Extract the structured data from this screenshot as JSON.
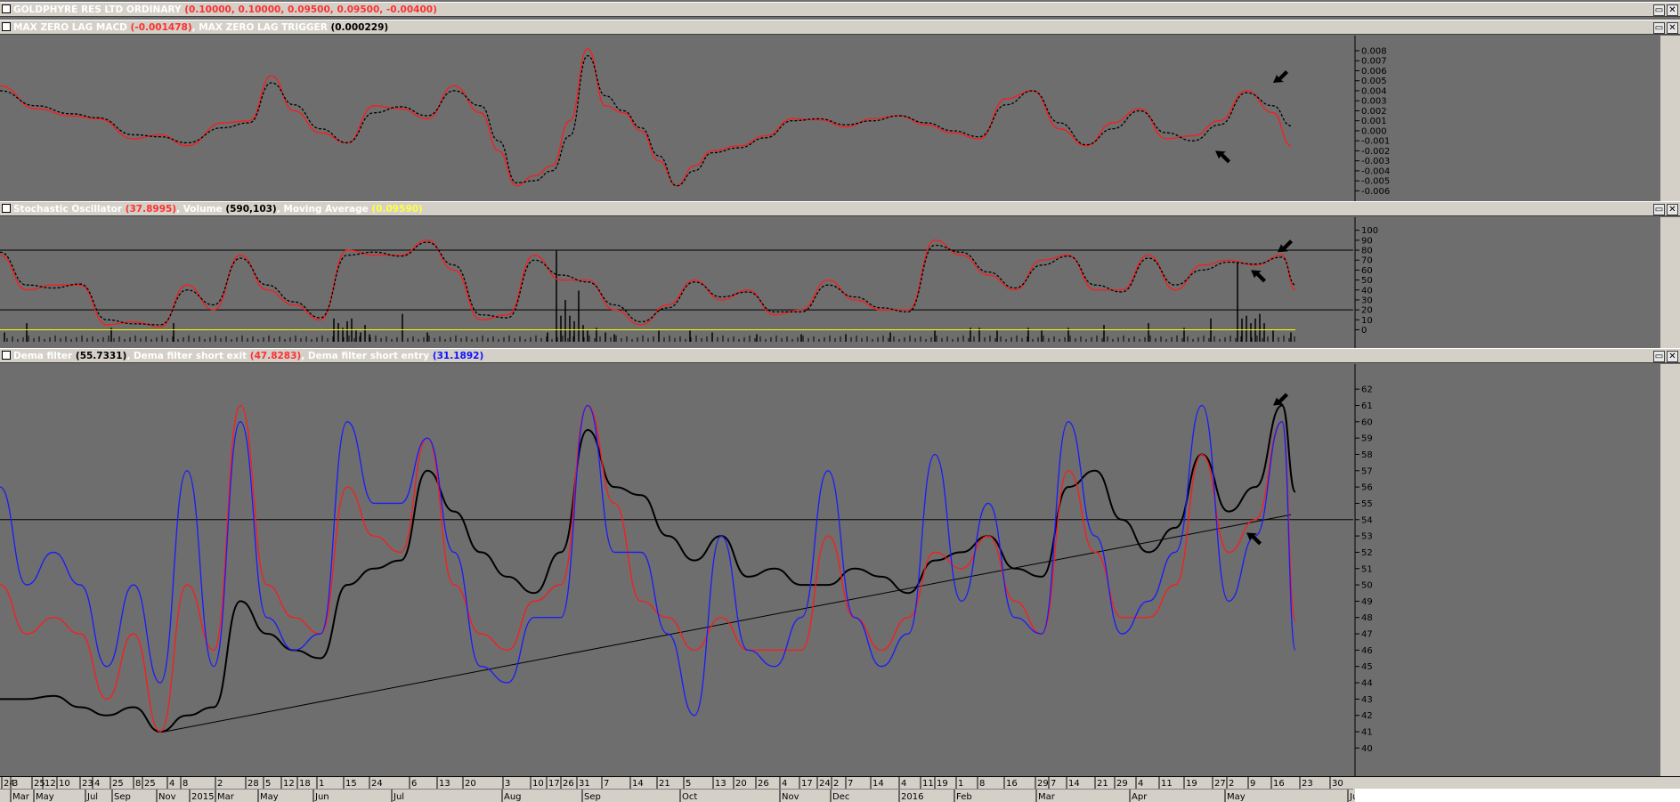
{
  "bars": [
    {
      "name": "GOLDPHYRE RES LTD ORDINARY",
      "value": "(0.10000, 0.10000, 0.09500, 0.09500, -0.00400)"
    },
    {
      "parts": [
        {
          "t": "MAX ZERO LAG MACD ",
          "c": "w"
        },
        {
          "t": "(-0.001478)",
          "c": "red"
        },
        {
          "t": ", MAX ZERO LAG TRIGGER ",
          "c": "w"
        },
        {
          "t": "(0.000229)",
          "c": "blk"
        }
      ]
    },
    {
      "parts": [
        {
          "t": "Stochastic Oscillator ",
          "c": "w"
        },
        {
          "t": "(37.8995)",
          "c": "red"
        },
        {
          "t": ", Volume ",
          "c": "w"
        },
        {
          "t": "(590,103)",
          "c": "blk"
        },
        {
          "t": ", Moving Average ",
          "c": "w"
        },
        {
          "t": "(0.09590)",
          "c": "yel"
        }
      ]
    },
    {
      "parts": [
        {
          "t": "Dema filter ",
          "c": "w"
        },
        {
          "t": "(55.7331)",
          "c": "blk"
        },
        {
          "t": ", Dema filter short exit ",
          "c": "w"
        },
        {
          "t": "(47.8283)",
          "c": "red"
        },
        {
          "t": ", Dema filter short entry ",
          "c": "w"
        },
        {
          "t": "(31.1892)",
          "c": "blu"
        }
      ]
    }
  ],
  "buttons": {
    "restore": "▭",
    "close": "✕"
  },
  "colors": {
    "background": "#6e6e6e",
    "red": "#ff1a1a",
    "black": "#000000",
    "blue": "#1a1aff",
    "yellow": "#ffff00",
    "axis": "#d4d0c8"
  },
  "chart_data": [
    {
      "type": "line",
      "id": "macd",
      "ylim": [
        -0.0065,
        0.0088
      ],
      "yticks": [
        "0.008",
        "0.007",
        "0.006",
        "0.005",
        "0.004",
        "0.003",
        "0.002",
        "0.001",
        "0.000",
        "-0.001",
        "-0.002",
        "-0.003",
        "-0.004",
        "-0.005",
        "-0.006"
      ],
      "ytick_values": [
        0.008,
        0.007,
        0.006,
        0.005,
        0.004,
        0.003,
        0.002,
        0.001,
        0.0,
        -0.001,
        -0.002,
        -0.003,
        -0.004,
        -0.005,
        -0.006
      ],
      "x": [
        0,
        40,
        80,
        110,
        150,
        180,
        210,
        250,
        280,
        305,
        330,
        360,
        390,
        420,
        450,
        480,
        510,
        540,
        560,
        580,
        600,
        620,
        640,
        660,
        680,
        700,
        720,
        740,
        760,
        780,
        800,
        830,
        860,
        890,
        920,
        950,
        980,
        1010,
        1040,
        1070,
        1100,
        1130,
        1160,
        1190,
        1220,
        1250,
        1280,
        1310,
        1340,
        1370,
        1400,
        1430,
        1450
      ],
      "series": [
        {
          "name": "MAX ZERO LAG MACD",
          "color": "red",
          "style": "solid",
          "values": [
            0.0045,
            0.0022,
            0.0015,
            0.0012,
            -0.0008,
            -0.0004,
            -0.0015,
            0.0008,
            0.001,
            0.0055,
            0.002,
            -0.0002,
            -0.0012,
            0.0025,
            0.0022,
            0.0012,
            0.0045,
            0.0018,
            -0.002,
            -0.0055,
            -0.0045,
            -0.0035,
            0.001,
            0.0082,
            0.0025,
            0.0018,
            0.0,
            -0.003,
            -0.0055,
            -0.0035,
            -0.002,
            -0.0015,
            -0.0005,
            0.0012,
            0.0011,
            0.0004,
            0.0012,
            0.0015,
            0.0006,
            -0.0002,
            -0.0008,
            0.0032,
            0.004,
            0.0002,
            -0.0015,
            0.0008,
            0.0022,
            -0.0008,
            -0.0005,
            0.001,
            0.004,
            0.0018,
            -0.0015
          ]
        },
        {
          "name": "MAX ZERO LAG TRIGGER",
          "color": "black",
          "style": "dashed",
          "values": [
            0.004,
            0.0025,
            0.0017,
            0.0013,
            -0.0004,
            -0.0006,
            -0.0012,
            0.0003,
            0.0008,
            0.0048,
            0.0026,
            0.0002,
            -0.0012,
            0.0018,
            0.0024,
            0.0015,
            0.004,
            0.0025,
            -0.001,
            -0.0052,
            -0.005,
            -0.004,
            -0.0005,
            0.0075,
            0.0035,
            0.002,
            0.0003,
            -0.0025,
            -0.0055,
            -0.004,
            -0.0022,
            -0.0017,
            -0.0007,
            0.001,
            0.0012,
            0.0006,
            0.001,
            0.0015,
            0.0008,
            0.0,
            -0.0006,
            0.0026,
            0.004,
            0.0008,
            -0.0014,
            0.0002,
            0.002,
            -0.0002,
            -0.001,
            0.0006,
            0.0038,
            0.0025,
            0.0005
          ]
        }
      ],
      "annotations": [
        {
          "type": "arrow",
          "dir": "down-left",
          "x": 1430,
          "value": 0.0048
        },
        {
          "type": "arrow",
          "dir": "up-left",
          "x": 1365,
          "value": -0.002
        }
      ]
    },
    {
      "type": "line",
      "id": "stochastic",
      "ylim": [
        -13,
        106
      ],
      "yticks": [
        "100",
        "90",
        "80",
        "70",
        "60",
        "50",
        "40",
        "30",
        "20",
        "10",
        "0"
      ],
      "ytick_values": [
        100,
        90,
        80,
        70,
        60,
        50,
        40,
        30,
        20,
        10,
        0
      ],
      "hlines": [
        80,
        20
      ],
      "x": [
        0,
        30,
        60,
        90,
        120,
        150,
        180,
        210,
        240,
        270,
        300,
        330,
        360,
        390,
        420,
        450,
        480,
        510,
        540,
        570,
        600,
        630,
        660,
        690,
        720,
        750,
        780,
        810,
        840,
        870,
        900,
        930,
        960,
        990,
        1020,
        1050,
        1080,
        1110,
        1140,
        1170,
        1200,
        1230,
        1260,
        1290,
        1320,
        1350,
        1380,
        1410,
        1440,
        1455
      ],
      "series": [
        {
          "name": "Stochastic Oscillator",
          "color": "red",
          "style": "solid",
          "values": [
            75,
            40,
            45,
            45,
            5,
            8,
            3,
            45,
            20,
            75,
            40,
            25,
            10,
            80,
            75,
            75,
            90,
            60,
            10,
            15,
            75,
            50,
            50,
            20,
            5,
            25,
            50,
            30,
            40,
            15,
            20,
            50,
            30,
            20,
            20,
            90,
            75,
            55,
            40,
            70,
            75,
            40,
            40,
            75,
            40,
            65,
            70,
            65,
            75,
            40
          ]
        },
        {
          "name": "Stochastic Signal",
          "color": "black",
          "style": "dashed",
          "values": [
            78,
            45,
            42,
            46,
            10,
            6,
            5,
            40,
            25,
            72,
            45,
            28,
            12,
            75,
            78,
            74,
            88,
            65,
            15,
            12,
            70,
            55,
            48,
            25,
            8,
            22,
            48,
            33,
            38,
            18,
            18,
            45,
            33,
            22,
            18,
            85,
            78,
            58,
            42,
            65,
            74,
            45,
            38,
            72,
            45,
            60,
            68,
            66,
            73,
            45
          ]
        }
      ],
      "volume_x": [
        5,
        30,
        125,
        195,
        375,
        380,
        385,
        390,
        395,
        400,
        405,
        410,
        415,
        452,
        480,
        615,
        625,
        630,
        635,
        640,
        645,
        650,
        655,
        660,
        670,
        680,
        690,
        740,
        775,
        800,
        850,
        900,
        950,
        1000,
        1050,
        1090,
        1100,
        1120,
        1155,
        1170,
        1200,
        1240,
        1290,
        1330,
        1360,
        1390,
        1395,
        1400,
        1405,
        1410,
        1415,
        1420,
        1430,
        1450
      ],
      "volume_values": [
        10,
        20,
        15,
        20,
        25,
        20,
        15,
        22,
        25,
        12,
        10,
        18,
        8,
        30,
        10,
        10,
        98,
        28,
        45,
        28,
        22,
        55,
        18,
        12,
        15,
        10,
        8,
        12,
        12,
        10,
        8,
        8,
        8,
        10,
        12,
        15,
        15,
        12,
        15,
        12,
        15,
        18,
        20,
        15,
        25,
        85,
        25,
        28,
        20,
        25,
        30,
        20,
        12,
        10
      ],
      "volume_ylim": [
        0,
        120
      ],
      "moving_average": 0,
      "annotations": [
        {
          "type": "arrow",
          "dir": "down-left",
          "x": 1435,
          "value": 78
        },
        {
          "type": "arrow",
          "dir": "up-left",
          "x": 1405,
          "value": 60
        }
      ]
    },
    {
      "type": "line",
      "id": "dema",
      "ylim": [
        38.6,
        63.1
      ],
      "yticks": [
        "62",
        "61",
        "60",
        "59",
        "58",
        "57",
        "56",
        "55",
        "54",
        "53",
        "52",
        "51",
        "50",
        "49",
        "48",
        "47",
        "46",
        "45",
        "44",
        "43",
        "42",
        "41",
        "40"
      ],
      "ytick_values": [
        62,
        61,
        60,
        59,
        58,
        57,
        56,
        55,
        54,
        53,
        52,
        51,
        50,
        49,
        48,
        47,
        46,
        45,
        44,
        43,
        42,
        41,
        40
      ],
      "hlines": [
        54
      ],
      "trendline": {
        "x": [
          185,
          1450
        ],
        "values": [
          41,
          54.3
        ]
      },
      "x": [
        0,
        30,
        60,
        90,
        120,
        150,
        180,
        210,
        240,
        270,
        300,
        330,
        360,
        390,
        420,
        450,
        480,
        510,
        540,
        570,
        600,
        630,
        660,
        690,
        720,
        750,
        780,
        810,
        840,
        870,
        900,
        930,
        960,
        990,
        1020,
        1050,
        1080,
        1110,
        1140,
        1170,
        1200,
        1230,
        1260,
        1290,
        1320,
        1350,
        1380,
        1410,
        1440,
        1455
      ],
      "series": [
        {
          "name": "Dema filter",
          "color": "black",
          "style": "solid",
          "width": 2,
          "values": [
            43,
            43,
            43.2,
            42.5,
            42,
            42.5,
            41,
            42,
            42.5,
            49,
            47,
            46,
            45.5,
            50,
            51,
            51.5,
            57,
            54.5,
            52,
            50.5,
            49.5,
            52,
            59.5,
            56,
            55.5,
            53,
            51.5,
            53,
            50.5,
            51,
            50,
            50,
            51,
            50.5,
            49.5,
            51.5,
            52,
            53,
            51,
            50.5,
            56,
            57,
            54,
            52,
            53.5,
            58,
            54.5,
            56,
            61,
            55.7
          ]
        },
        {
          "name": "Dema filter short exit",
          "color": "red",
          "style": "solid",
          "values": [
            50,
            47,
            48,
            47,
            43,
            47,
            41,
            50,
            46,
            61,
            50,
            48,
            47,
            56,
            53,
            52,
            59,
            50,
            47,
            46,
            49,
            50,
            61,
            55,
            49,
            48,
            46,
            48,
            46,
            46,
            46,
            53,
            48,
            46,
            48,
            52,
            51,
            53,
            49,
            47,
            57,
            52,
            48,
            48,
            50,
            58,
            52,
            54,
            60,
            47.8
          ]
        },
        {
          "name": "Dema filter short entry",
          "color": "blue",
          "style": "solid",
          "values": [
            56,
            50,
            52,
            50,
            45,
            50,
            44,
            57,
            45,
            60,
            48,
            46,
            47,
            60,
            55,
            55,
            59,
            52,
            45,
            44,
            48,
            48,
            61,
            52,
            52,
            47,
            42,
            53,
            46,
            45,
            48,
            57,
            48,
            45,
            47,
            58,
            49,
            55,
            48,
            47,
            60,
            53,
            47,
            49,
            52,
            61,
            49,
            53,
            60,
            46
          ]
        }
      ],
      "annotations": [
        {
          "type": "arrow",
          "dir": "down-left",
          "x": 1430,
          "value": 61
        },
        {
          "type": "arrow",
          "dir": "up-left",
          "x": 1400,
          "value": 53.2
        }
      ]
    }
  ],
  "time_axis": {
    "days": [
      "24",
      "3",
      "25",
      "12",
      "10",
      "23",
      "4",
      "25",
      "8",
      "25",
      "4",
      "8",
      "2",
      "28",
      "5",
      "12",
      "18",
      "1",
      "15",
      "24",
      "6",
      "13",
      "20",
      "3",
      "10",
      "17",
      "26",
      "31",
      "7",
      "14",
      "21",
      "5",
      "13",
      "20",
      "26",
      "4",
      "17",
      "24",
      "2",
      "7",
      "14",
      "4",
      "11",
      "19",
      "1",
      "8",
      "16",
      "29",
      "7",
      "14",
      "21",
      "29",
      "4",
      "11",
      "19",
      "27",
      "2",
      "9",
      "16",
      "23",
      "30"
    ],
    "day_x": [
      4,
      14,
      38,
      50,
      66,
      92,
      106,
      126,
      152,
      162,
      190,
      205,
      244,
      278,
      298,
      318,
      336,
      358,
      388,
      417,
      462,
      493,
      522,
      567,
      598,
      616,
      632,
      650,
      678,
      710,
      740,
      770,
      803,
      826,
      851,
      878,
      900,
      920,
      936,
      952,
      980,
      1012,
      1036,
      1052,
      1076,
      1100,
      1130,
      1165,
      1180,
      1200,
      1232,
      1254,
      1278,
      1304,
      1332,
      1364,
      1380,
      1404,
      1430,
      1462,
      1496
    ],
    "months": [
      "Mar",
      "May",
      "Jul",
      "Sep",
      "Nov",
      "2015",
      "Mar",
      "May",
      "Jun",
      "Jul",
      "Aug",
      "Sep",
      "Oct",
      "Nov",
      "Dec",
      "2016",
      "Feb",
      "Mar",
      "Apr",
      "May",
      "Jun"
    ],
    "month_x": [
      14,
      40,
      98,
      128,
      178,
      215,
      244,
      292,
      354,
      442,
      566,
      656,
      766,
      878,
      935,
      1012,
      1074,
      1166,
      1271,
      1378,
      1516
    ]
  }
}
